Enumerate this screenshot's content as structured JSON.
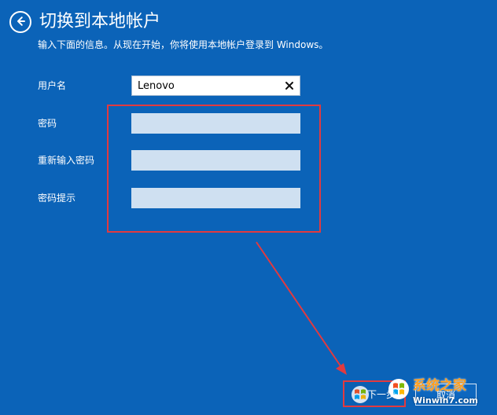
{
  "header": {
    "title": "切换到本地帐户",
    "back_icon": "arrow-left-circle-icon"
  },
  "subtitle": "输入下面的信息。从现在开始，你将使用本地帐户登录到 Windows。",
  "form": {
    "username_label": "用户名",
    "username_value": "Lenovo",
    "password_label": "密码",
    "password_value": "",
    "confirm_password_label": "重新输入密码",
    "confirm_password_value": "",
    "password_hint_label": "密码提示",
    "password_hint_value": "",
    "clear_icon": "close-icon"
  },
  "buttons": {
    "next_label": "下一步",
    "cancel_label": "取消"
  },
  "watermark": {
    "line1": "系统之家",
    "line2": "Winwin7.com"
  },
  "colors": {
    "background": "#0b63b8",
    "annotation": "#e23a3f",
    "input_disabled": "#cfe0f1",
    "input_active": "#ffffff",
    "watermark_orange": "#ff9f20"
  }
}
